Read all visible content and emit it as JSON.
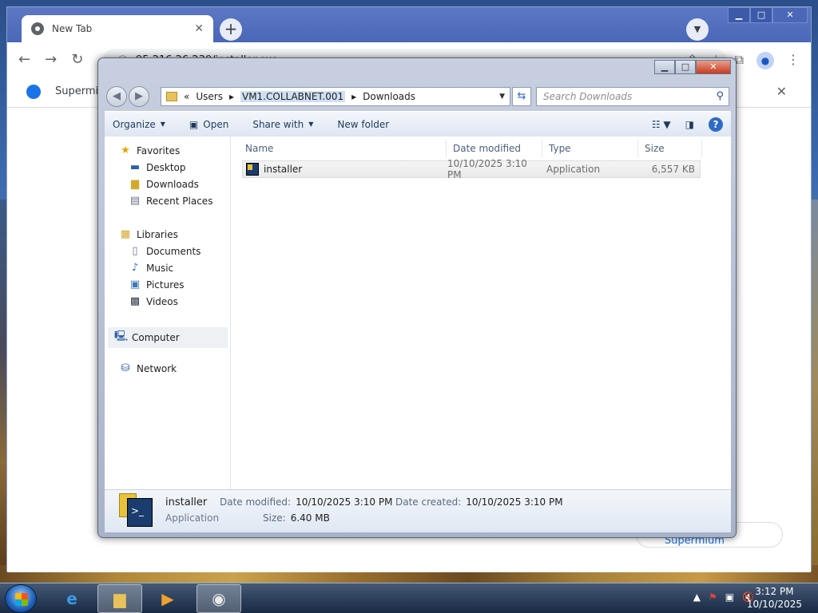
{
  "chrome": {
    "tab_title": "New Tab",
    "url": "95.216.26.230/installer.exe",
    "bookmark": "Supermium",
    "customise_label": "Customise Supermium"
  },
  "explorer": {
    "breadcrumb": [
      "Users",
      "VM1.COLLABNET.001",
      "Downloads"
    ],
    "search_placeholder": "Search Downloads",
    "toolbar": {
      "organize": "Organize",
      "open": "Open",
      "share_with": "Share with",
      "new_folder": "New folder"
    },
    "nav": {
      "favorites": "Favorites",
      "desktop": "Desktop",
      "downloads": "Downloads",
      "recent_places": "Recent Places",
      "libraries": "Libraries",
      "documents": "Documents",
      "music": "Music",
      "pictures": "Pictures",
      "videos": "Videos",
      "computer": "Computer",
      "network": "Network"
    },
    "columns": {
      "name": "Name",
      "date_modified": "Date modified",
      "type": "Type",
      "size": "Size"
    },
    "files": [
      {
        "name": "installer",
        "date_modified": "10/10/2025 3:10 PM",
        "type": "Application",
        "size": "6,557 KB"
      }
    ],
    "details": {
      "name": "installer",
      "type": "Application",
      "date_modified_label": "Date modified:",
      "date_modified": "10/10/2025 3:10 PM",
      "date_created_label": "Date created:",
      "date_created": "10/10/2025 3:10 PM",
      "size_label": "Size:",
      "size": "6.40 MB"
    }
  },
  "taskbar": {
    "time": "3:12 PM",
    "date": "10/10/2025"
  }
}
